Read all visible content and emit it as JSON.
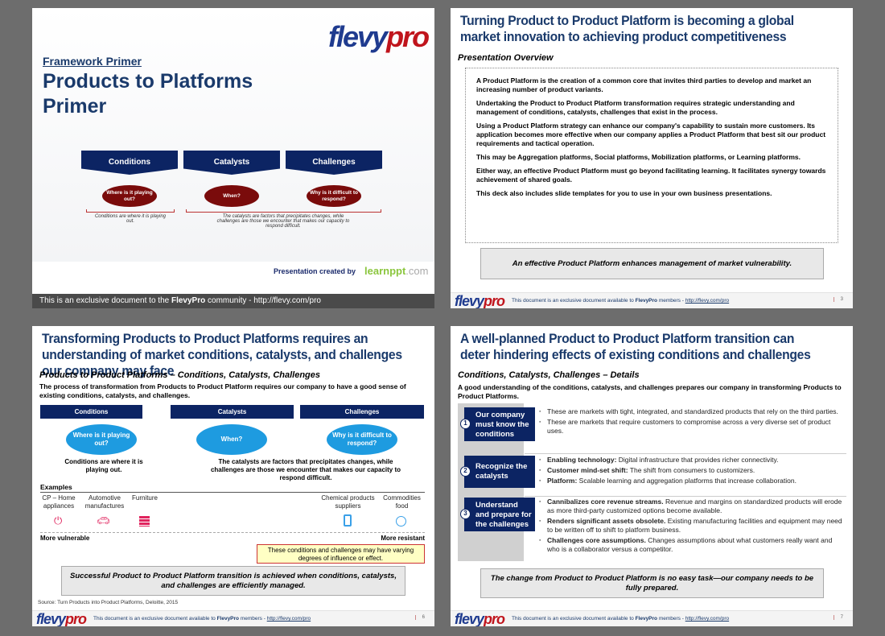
{
  "slide1": {
    "logo": "flevypro",
    "logo_f": "flevy",
    "logo_p": "pro",
    "kicker": "Framework Primer",
    "title": "Products to Platforms Primer",
    "headers": [
      "Conditions",
      "Catalysts",
      "Challenges"
    ],
    "questions": [
      "Where is it playing out?",
      "When?",
      "Why is it difficult to respond?"
    ],
    "note1": "Conditions are where it is playing out.",
    "note2": "The catalysts are factors that precipitates changes, while challenges are those we encounter that makes our capacity to respond difficult.",
    "created_by": "Presentation created by",
    "brand": "learnppt",
    "brand_suffix": ".com",
    "footer_pre": "This is an exclusive document to the ",
    "footer_bold": "FlevyPro",
    "footer_post": " community - http://flevy.com/pro"
  },
  "footer": {
    "pre": "This document is an exclusive document available to ",
    "bold": "FlevyPro",
    "mid": " members - ",
    "link": "http://flevy.com/pro"
  },
  "slide2": {
    "title": "Turning Product to Product Platform is becoming a global market innovation to achieving product competitiveness",
    "subtitle": "Presentation Overview",
    "paragraphs": [
      "A Product Platform is the creation of a common core that invites third parties to develop and market an increasing number of product variants.",
      "Undertaking the Product to Product Platform transformation requires strategic understanding and management of conditions, catalysts, challenges that exist in the process.",
      "Using a Product Platform strategy can enhance our company's capability to sustain more customers. Its application becomes more effective when our company applies a Product Platform that best sit our product requirements and tactical operation.",
      "This may be Aggregation platforms, Social platforms, Mobilization platforms, or Learning platforms.",
      "Either way, an effective Product Platform must go beyond facilitating learning. It facilitates synergy towards achievement of shared goals.",
      "This deck also includes slide templates for you to use in your own business presentations."
    ],
    "summary": "An effective Product Platform enhances management of market vulnerability.",
    "page": "3"
  },
  "slide3": {
    "title": "Transforming Products to Product Platforms requires an understanding of market conditions, catalysts, and challenges our company may face",
    "subtitle": "Products to Product Platforms – Conditions, Catalysts, Challenges",
    "intro": "The process of transformation from Products to Product Platform requires our company to have a good sense of existing conditions, catalysts, and challenges.",
    "headers": [
      "Conditions",
      "Catalysts",
      "Challenges"
    ],
    "questions": [
      "Where is it playing out?",
      "When?",
      "Why is it difficult to respond?"
    ],
    "note1": "Conditions are where it is playing out.",
    "note2": "The catalysts are factors that precipitates changes, while challenges are those we encounter that makes our capacity to respond difficult.",
    "examples_label": "Examples",
    "examples": [
      {
        "label": "CP – Home appliances",
        "icon": "plug-icon"
      },
      {
        "label": "Automotive manufactures",
        "icon": "car-icon"
      },
      {
        "label": "Furniture",
        "icon": "drawer-icon"
      },
      {
        "label": "Chemical products suppliers",
        "icon": "chemical-icon"
      },
      {
        "label": "Commodities food",
        "icon": "apple-icon"
      }
    ],
    "left_end": "More vulnerable",
    "right_end": "More resistant",
    "callout": "These conditions and challenges may have varying degrees of influence or effect.",
    "summary": "Successful Product to Product Platform transition is achieved when conditions, catalysts, and challenges are efficiently managed.",
    "source": "Source: Turn Products into Product Platforms, Deloitte, 2015",
    "page": "6",
    "colors": {
      "vulnerable": "#e0245e",
      "resistant": "#3aa0e8"
    }
  },
  "slide4": {
    "title": "A well-planned Product to Product Platform transition can deter hindering effects of existing conditions and challenges",
    "subtitle": "Conditions, Catalysts, Challenges – Details",
    "intro": "A good understanding of the conditions, catalysts, and challenges prepares our company in transforming Products to Product Platforms.",
    "rows": [
      {
        "num": "1",
        "label": "Our company must know the conditions",
        "bullets": [
          {
            "b": "",
            "t": "These are markets with tight, integrated, and standardized products that rely on the third parties."
          },
          {
            "b": "",
            "t": "These are markets that require customers to compromise across a very diverse set of product uses."
          }
        ]
      },
      {
        "num": "2",
        "label": "Recognize the catalysts",
        "bullets": [
          {
            "b": "Enabling technology:",
            "t": "  Digital infrastructure that provides richer connectivity."
          },
          {
            "b": "Customer mind-set shift:",
            "t": "  The shift from consumers to customizers."
          },
          {
            "b": "Platform:",
            "t": "  Scalable learning and aggregation platforms that increase collaboration."
          }
        ]
      },
      {
        "num": "3",
        "label": "Understand and prepare for the challenges",
        "bullets": [
          {
            "b": "Cannibalizes core revenue streams.",
            "t": "  Revenue and margins on standardized products will erode as more third-party customized options become available."
          },
          {
            "b": "Renders significant assets obsolete.",
            "t": " Existing manufacturing facilities and equipment may need to be written off to shift to platform business."
          },
          {
            "b": "Challenges core assumptions.",
            "t": " Changes assumptions about what customers really want and who is a collaborator versus a competitor."
          }
        ]
      }
    ],
    "summary": "The change from Product to Product Platform is no easy task—our company needs to be fully prepared.",
    "page": "7"
  }
}
